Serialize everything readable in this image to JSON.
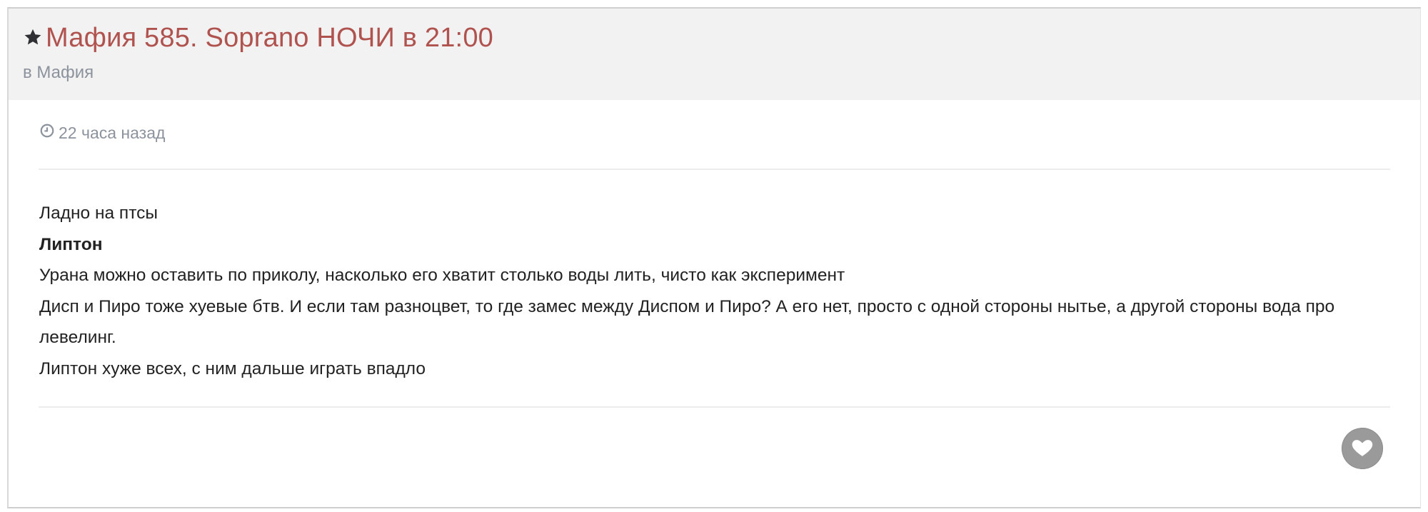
{
  "post": {
    "title": "Мафия 585. Soprano НОЧИ в 21:00",
    "forum_prefix": "в",
    "forum_name": "Мафия",
    "timestamp": "22 часа назад",
    "lines": [
      "Ладно на птсы",
      "Липтон",
      "Урана можно оставить по приколу, насколько его хватит столько воды лить, чисто как эксперимент",
      "Дисп и Пиро тоже хуевые бтв. И если там разноцвет, то где замес между Диспом и Пиро? А его нет, просто с одной стороны нытье, а другой стороны вода про левелинг.",
      "Липтон хуже всех,  с ним дальше играть впадло"
    ]
  },
  "icons": {
    "title_icon": "star-icon",
    "time_icon": "clock-icon",
    "like_icon": "heart-icon"
  },
  "colors": {
    "title": "#b0534f",
    "muted": "#8c939d",
    "header_bg": "#f2f2f2",
    "like_bg": "#9a9a9a"
  }
}
